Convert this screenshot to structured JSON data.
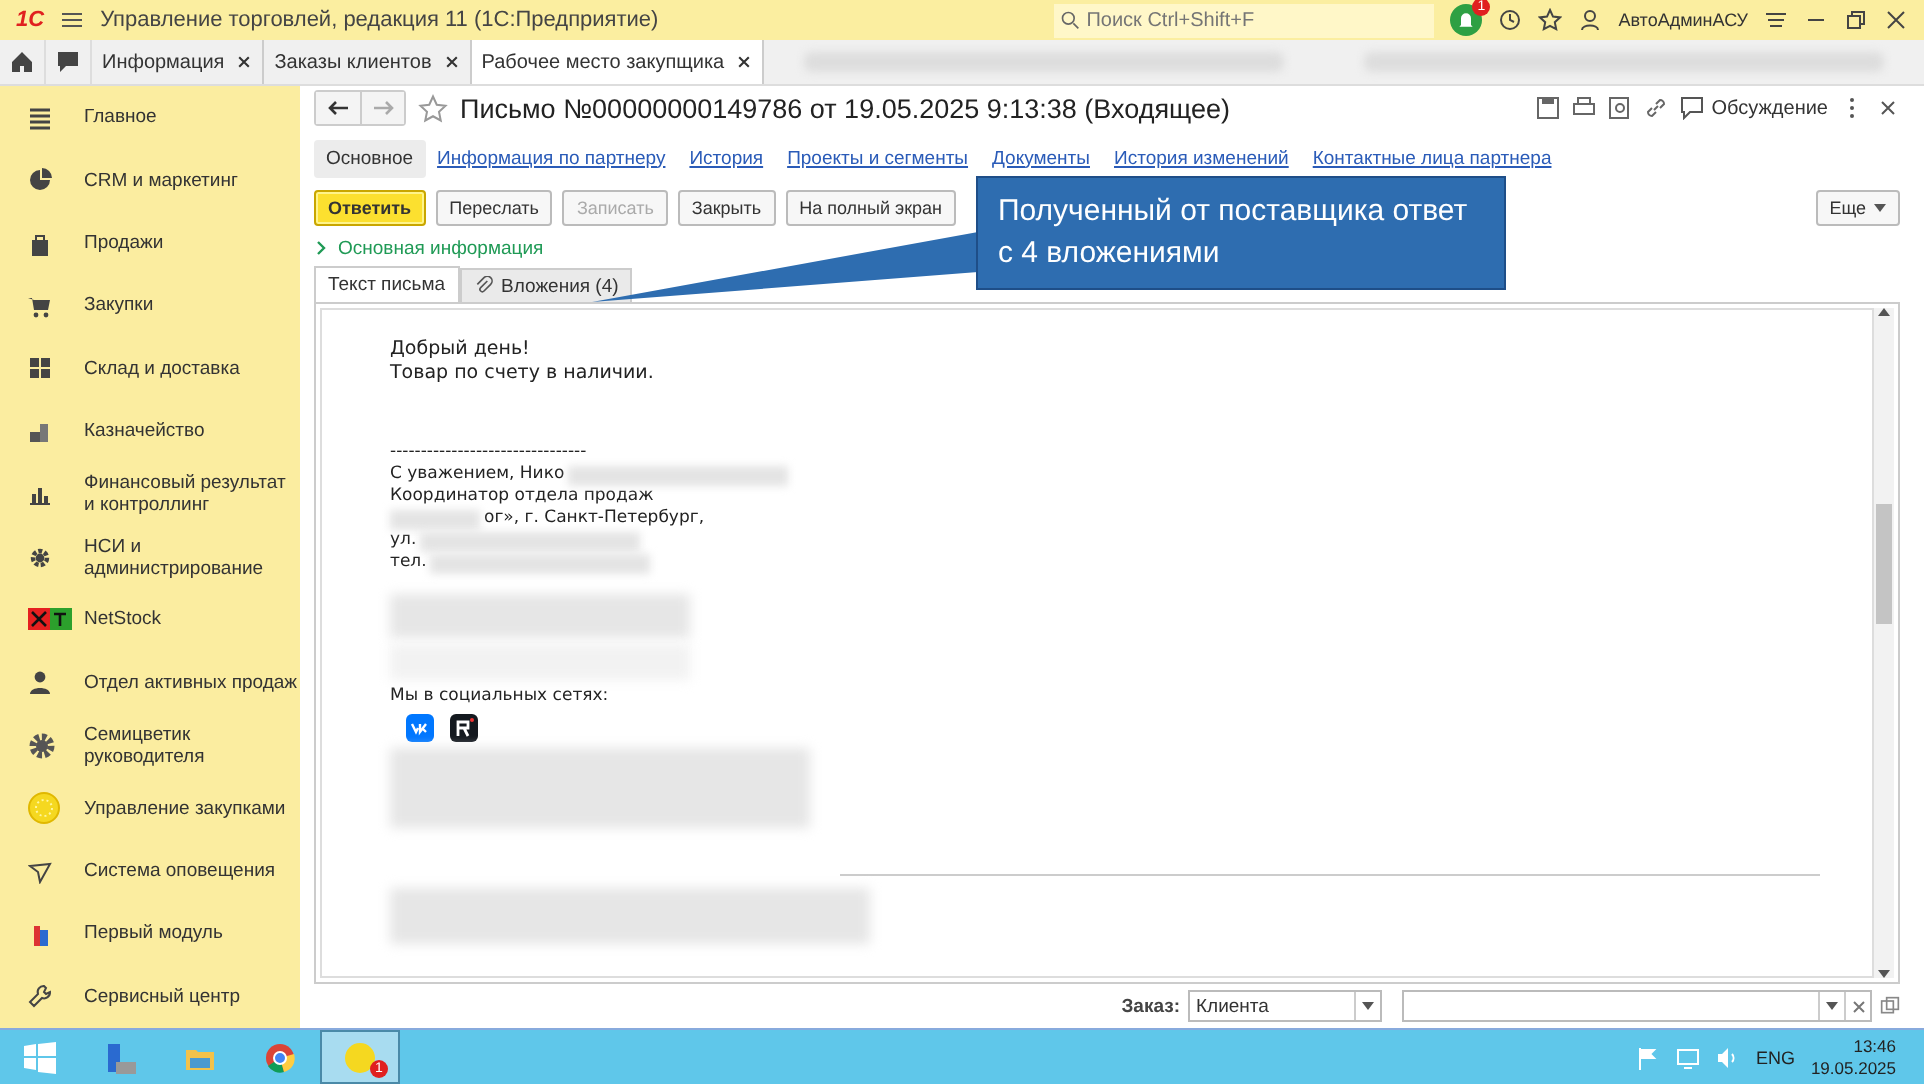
{
  "app_bar": {
    "logo": "1С",
    "title": "Управление торговлей, редакция 11  (1С:Предприятие)",
    "search": {
      "placeholder": "Поиск Ctrl+Shift+F"
    },
    "notification_count": "1",
    "user": "АвтоАдминАСУ"
  },
  "open_tabs": [
    {
      "label": "Информация",
      "selected": false
    },
    {
      "label": "Заказы клиентов",
      "selected": false
    },
    {
      "label": "Рабочее место закупщика",
      "selected": true
    }
  ],
  "sidebar": {
    "items": [
      {
        "label": "Главное"
      },
      {
        "label": "CRM и маркетинг"
      },
      {
        "label": "Продажи"
      },
      {
        "label": "Закупки"
      },
      {
        "label": "Склад и доставка"
      },
      {
        "label": "Казначейство"
      },
      {
        "label": "Финансовый результат и контроллинг"
      },
      {
        "label": "НСИ и администрирование"
      },
      {
        "label": "NetStock"
      },
      {
        "label": "Отдел активных продаж"
      },
      {
        "label": "Семицветик руководителя"
      },
      {
        "label": "Управление закупками"
      },
      {
        "label": "Система оповещения"
      },
      {
        "label": "Первый модуль"
      },
      {
        "label": "Сервисный центр"
      }
    ]
  },
  "form": {
    "title": "Письмо №00000000149786 от 19.05.2025 9:13:38 (Входящее)",
    "starred": false,
    "discussion": "Обсуждение",
    "nav": [
      {
        "label": "Основное",
        "selected": true
      },
      {
        "label": "Информация по партнеру",
        "selected": false
      },
      {
        "label": "История",
        "selected": false
      },
      {
        "label": "Проекты и сегменты",
        "selected": false
      },
      {
        "label": "Документы",
        "selected": false
      },
      {
        "label": "История изменений",
        "selected": false
      },
      {
        "label": "Контактные лица партнера",
        "selected": false
      }
    ],
    "buttons": [
      {
        "label": "Ответить",
        "kind": "primary",
        "disabled": false
      },
      {
        "label": "Переслать",
        "kind": "normal",
        "disabled": false
      },
      {
        "label": "Записать",
        "kind": "normal",
        "disabled": true
      },
      {
        "label": "Закрыть",
        "kind": "normal",
        "disabled": false
      },
      {
        "label": "На полный экран",
        "kind": "normal",
        "disabled": false
      }
    ],
    "more_button": "Еще",
    "section": {
      "label": "Основная информация",
      "expanded": false
    },
    "tabs": [
      {
        "label": "Текст письма",
        "selected": true
      },
      {
        "label": "Вложения (4)",
        "selected": false
      }
    ],
    "email": {
      "greeting": [
        "Добрый день!",
        "Товар по счету в наличии."
      ],
      "separator": "--------------------------------",
      "signature": [
        {
          "text": "С уважением, Нико",
          "blurred_before": false,
          "blurred_after": true
        },
        {
          "text": "Координатор отдела продаж",
          "blurred_before": false,
          "blurred_after": false
        },
        {
          "text": "ог», г. Санкт-Петербург,",
          "blurred_before": true,
          "blurred_after": false
        },
        {
          "text": "ул.",
          "blurred_before": false,
          "blurred_after": true
        },
        {
          "text": "тел.",
          "blurred_before": false,
          "blurred_after": true
        }
      ],
      "social_label": "Мы в социальных сетях:"
    },
    "footer": {
      "order_label": "Заказ:",
      "order_type": "Клиента"
    }
  },
  "callout": {
    "lines": [
      "Полученный от поставщика ответ",
      "с 4 вложениями"
    ]
  },
  "taskbar": {
    "badge": "1",
    "lang": "ENG",
    "time": "13:46",
    "date": "19.05.2025"
  }
}
